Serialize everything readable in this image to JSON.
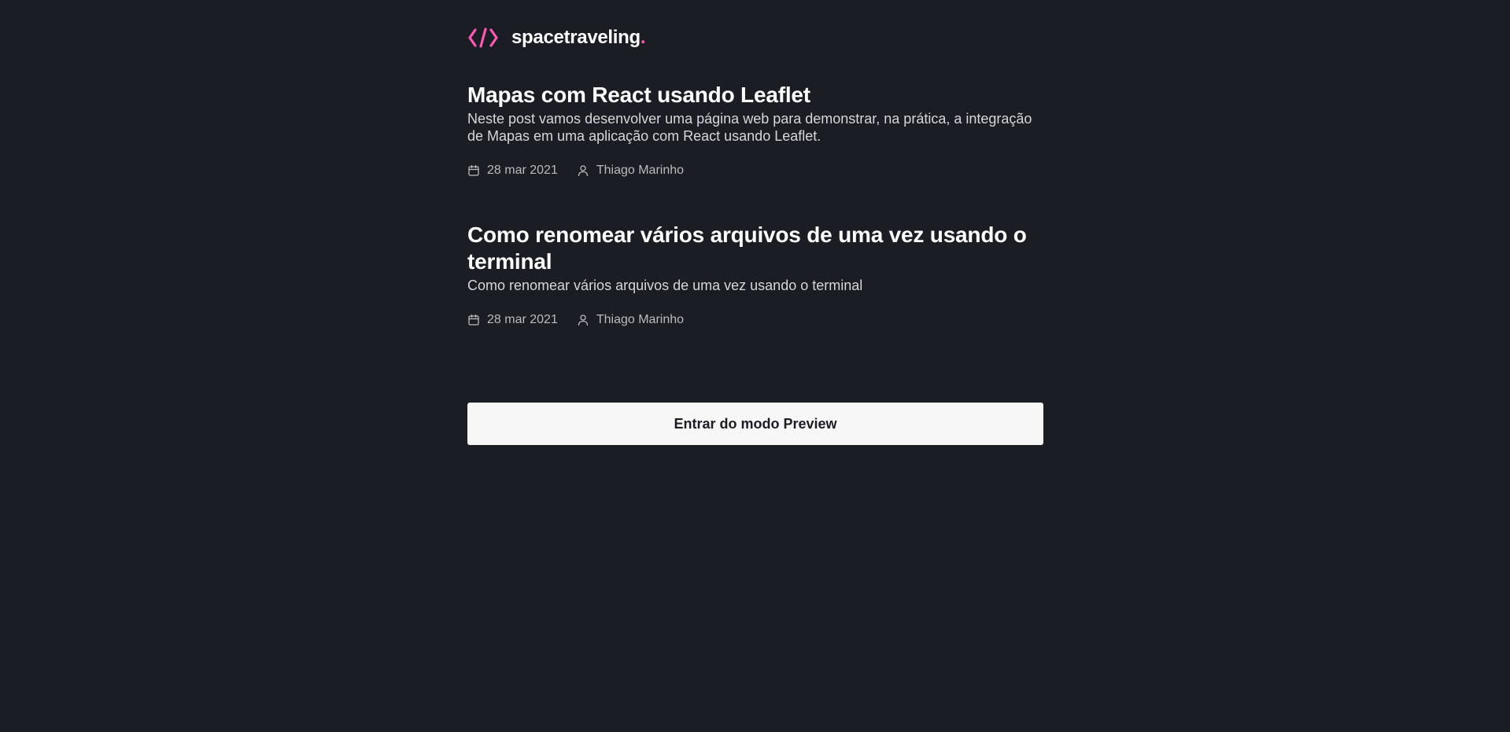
{
  "header": {
    "brand_name": "spacetraveling",
    "brand_dot": ".",
    "logo_icon": "code-brackets-icon",
    "accent_color": "#ff57b2"
  },
  "posts": [
    {
      "title": "Mapas com React usando Leaflet",
      "subtitle": "Neste post vamos desenvolver uma página web para demonstrar, na prática, a integração de Mapas em uma aplicação com React usando Leaflet.",
      "date": "28 mar 2021",
      "author": "Thiago Marinho",
      "date_icon": "calendar-icon",
      "author_icon": "user-icon"
    },
    {
      "title": "Como renomear vários arquivos de uma vez usando o terminal",
      "subtitle": "Como renomear vários arquivos de uma vez usando o terminal",
      "date": "28 mar 2021",
      "author": "Thiago Marinho",
      "date_icon": "calendar-icon",
      "author_icon": "user-icon"
    }
  ],
  "preview_button": {
    "label": "Entrar do modo Preview"
  },
  "colors": {
    "background": "#1a1d23",
    "title": "#ffffff",
    "subtitle": "#d7d7d7",
    "meta": "#bbbbbb",
    "button_bg": "#f7f7f7"
  }
}
